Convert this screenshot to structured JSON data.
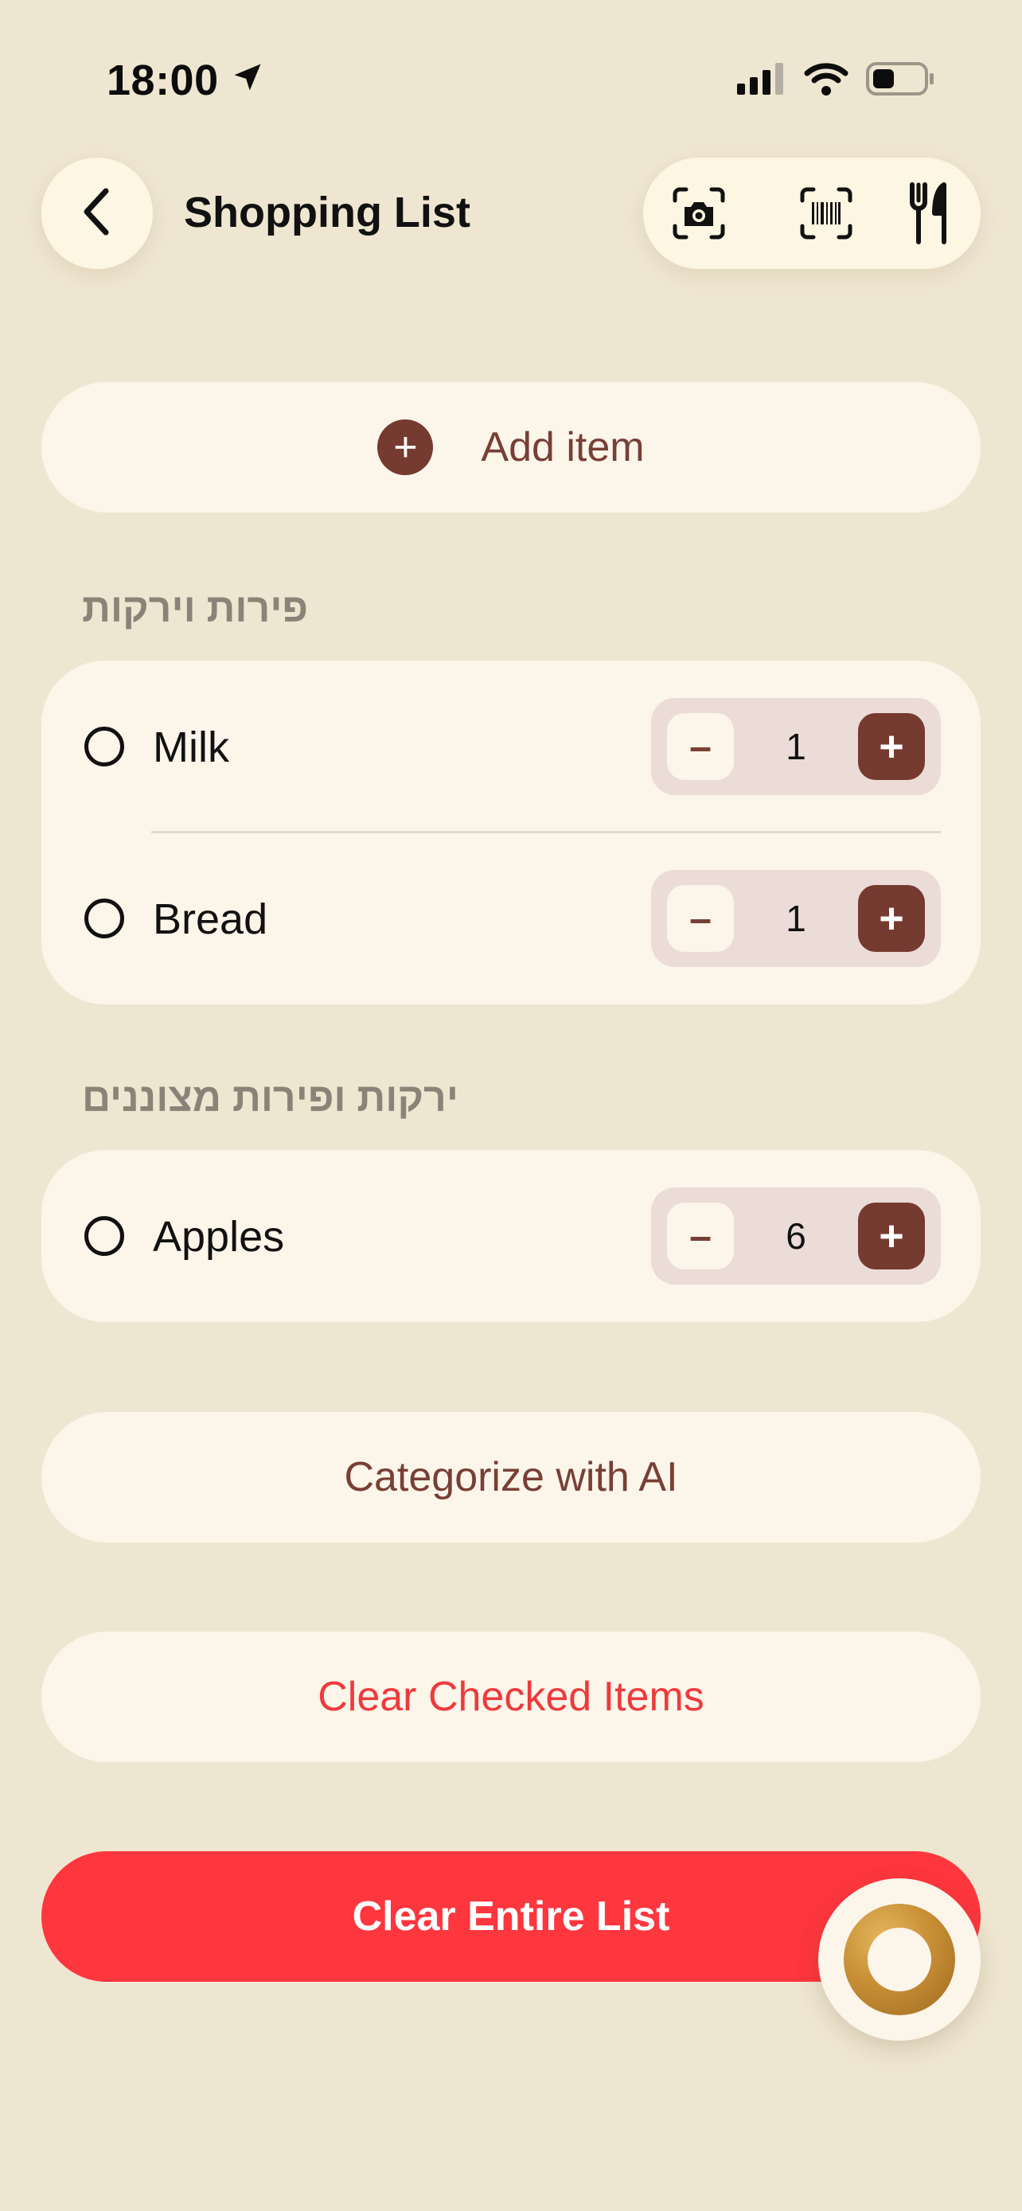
{
  "status_bar": {
    "time": "18:00",
    "icons": [
      "location-arrow-icon",
      "cellular-signal-icon",
      "wifi-icon",
      "battery-icon"
    ]
  },
  "header": {
    "title": "Shopping List",
    "back_icon": "chevron-left-icon",
    "toolbar_icons": [
      "camera-scan-icon",
      "barcode-scan-icon",
      "fork-knife-icon"
    ]
  },
  "add_item": {
    "label": "Add item",
    "icon": "plus-circle-icon"
  },
  "sections": [
    {
      "title": "פירות וירקות",
      "items": [
        {
          "name": "Milk",
          "quantity": "1",
          "checked": false
        },
        {
          "name": "Bread",
          "quantity": "1",
          "checked": false
        }
      ]
    },
    {
      "title": "ירקות ופירות מצוננים",
      "items": [
        {
          "name": "Apples",
          "quantity": "6",
          "checked": false
        }
      ]
    }
  ],
  "stepper": {
    "minus_label": "–",
    "plus_label": "+"
  },
  "actions": {
    "categorize_label": "Categorize with AI",
    "clear_checked_label": "Clear Checked Items",
    "clear_all_label": "Clear Entire List"
  },
  "colors": {
    "background": "#efe6d1",
    "card": "#fbf5ea",
    "accent_brown": "#753a30",
    "danger_red": "#fe363e",
    "danger_text": "#ee3a3c"
  }
}
